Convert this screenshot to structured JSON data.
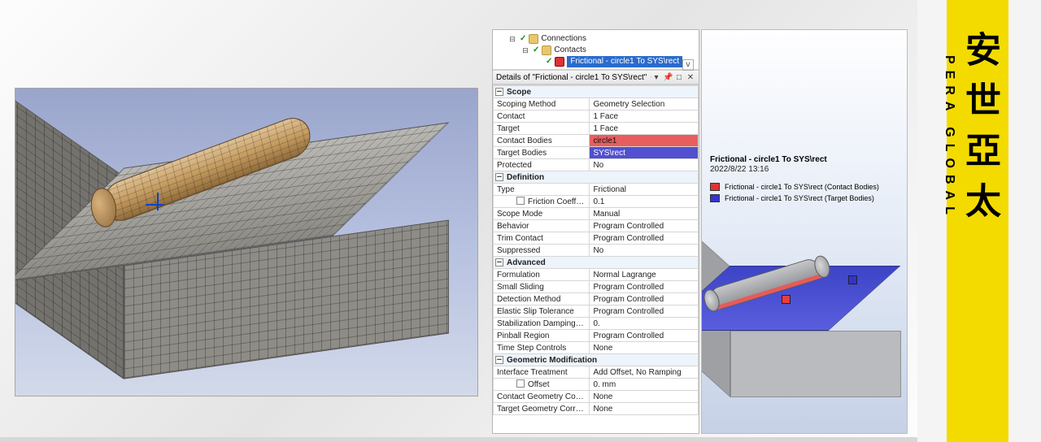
{
  "tree": {
    "root": "Connections",
    "child": "Contacts",
    "leaf": "Frictional - circle1 To SYS\\rect"
  },
  "details_title": "Details of \"Frictional - circle1 To SYS\\rect\"",
  "window_controls": {
    "pin": "📌",
    "dock": "□",
    "close": "✕",
    "dropdown": "▾"
  },
  "sections": {
    "scope": "Scope",
    "definition": "Definition",
    "advanced": "Advanced",
    "geomod": "Geometric Modification"
  },
  "rows": {
    "scoping_method": {
      "l": "Scoping Method",
      "v": "Geometry Selection"
    },
    "contact": {
      "l": "Contact",
      "v": "1 Face"
    },
    "target": {
      "l": "Target",
      "v": "1 Face"
    },
    "contact_bodies": {
      "l": "Contact Bodies",
      "v": "circle1"
    },
    "target_bodies": {
      "l": "Target Bodies",
      "v": "SYS\\rect"
    },
    "protected": {
      "l": "Protected",
      "v": "No"
    },
    "type": {
      "l": "Type",
      "v": "Frictional"
    },
    "friction_coeff": {
      "l": "Friction Coefficient",
      "v": "0.1"
    },
    "scope_mode": {
      "l": "Scope Mode",
      "v": "Manual"
    },
    "behavior": {
      "l": "Behavior",
      "v": "Program Controlled"
    },
    "trim_contact": {
      "l": "Trim Contact",
      "v": "Program Controlled"
    },
    "suppressed": {
      "l": "Suppressed",
      "v": "No"
    },
    "formulation": {
      "l": "Formulation",
      "v": "Normal Lagrange"
    },
    "small_sliding": {
      "l": "Small Sliding",
      "v": "Program Controlled"
    },
    "detection_method": {
      "l": "Detection Method",
      "v": "Program Controlled"
    },
    "elastic_slip": {
      "l": "Elastic Slip Tolerance",
      "v": "Program Controlled"
    },
    "stab_damp": {
      "l": "Stabilization Damping Factor",
      "v": "0."
    },
    "pinball": {
      "l": "Pinball Region",
      "v": "Program Controlled"
    },
    "time_step": {
      "l": "Time Step Controls",
      "v": "None"
    },
    "interface": {
      "l": "Interface Treatment",
      "v": "Add Offset, No Ramping"
    },
    "offset": {
      "l": "Offset",
      "v": "0. mm"
    },
    "contact_geom": {
      "l": "Contact Geometry Correction",
      "v": "None"
    },
    "target_geom": {
      "l": "Target Geometry Correction",
      "v": "None"
    }
  },
  "right": {
    "title": "Frictional - circle1 To SYS\\rect",
    "date": "2022/8/22 13:16",
    "legend_contact": "Frictional - circle1 To SYS\\rect (Contact Bodies)",
    "legend_target": "Frictional - circle1 To SYS\\rect (Target Bodies)"
  },
  "brand": {
    "cn": "安世亞太",
    "en": "PERA GLOBAL"
  },
  "colors": {
    "contact": "#e85e5e",
    "target": "#5050d0"
  }
}
